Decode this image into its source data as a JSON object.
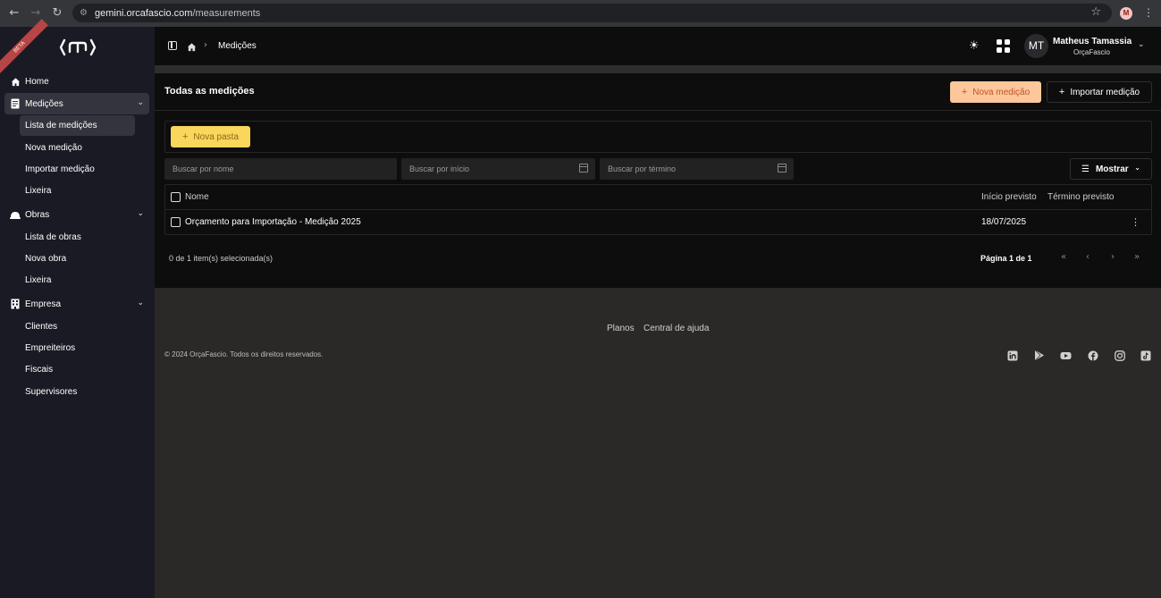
{
  "browser": {
    "url_host": "gemini.orcafascio.com",
    "url_path": "/measurements",
    "profile_initial": "M"
  },
  "sidebar": {
    "ribbon": "BETA",
    "groups": [
      {
        "label": "Home",
        "icon": "home-icon"
      },
      {
        "label": "Medições",
        "icon": "document-icon",
        "items": [
          "Lista de medições",
          "Nova medição",
          "Importar medição",
          "Lixeira"
        ]
      },
      {
        "label": "Obras",
        "icon": "helmet-icon",
        "items": [
          "Lista de obras",
          "Nova obra",
          "Lixeira"
        ]
      },
      {
        "label": "Empresa",
        "icon": "building-icon",
        "items": [
          "Clientes",
          "Empreiteiros",
          "Fiscais",
          "Supervisores"
        ]
      }
    ]
  },
  "topbar": {
    "breadcrumb": "Medições",
    "user": {
      "initials": "MT",
      "name": "Matheus Tamassia",
      "org": "OrçaFascio"
    }
  },
  "main": {
    "title": "Todas as medições",
    "new_button": "Nova medição",
    "import_button": "Importar medição",
    "new_folder_button": "Nova pasta",
    "search_name_placeholder": "Buscar por nome",
    "search_start_placeholder": "Buscar por início",
    "search_end_placeholder": "Buscar por término",
    "show_button": "Mostrar",
    "table": {
      "headers": {
        "name": "Nome",
        "start": "Início previsto",
        "end": "Término previsto"
      },
      "rows": [
        {
          "name": "Orçamento para Importação - Medição 2025",
          "start": "18/07/2025",
          "end": ""
        }
      ]
    },
    "selection": "0 de 1 item(s) selecionada(s)",
    "pagination": "Página 1 de 1"
  },
  "footer": {
    "links": [
      "Planos",
      "Central de ajuda"
    ],
    "copyright": "© 2024 OrçaFascio. Todos os direitos reservados.",
    "social": [
      "linkedin-icon",
      "google-play-icon",
      "youtube-icon",
      "facebook-icon",
      "instagram-icon",
      "tiktok-icon"
    ]
  },
  "colors": {
    "sidebar_bg": "#1a1a24",
    "primary_button": "#fcc79b",
    "folder_button": "#f9d65c",
    "footer_bg": "#2b2828"
  }
}
